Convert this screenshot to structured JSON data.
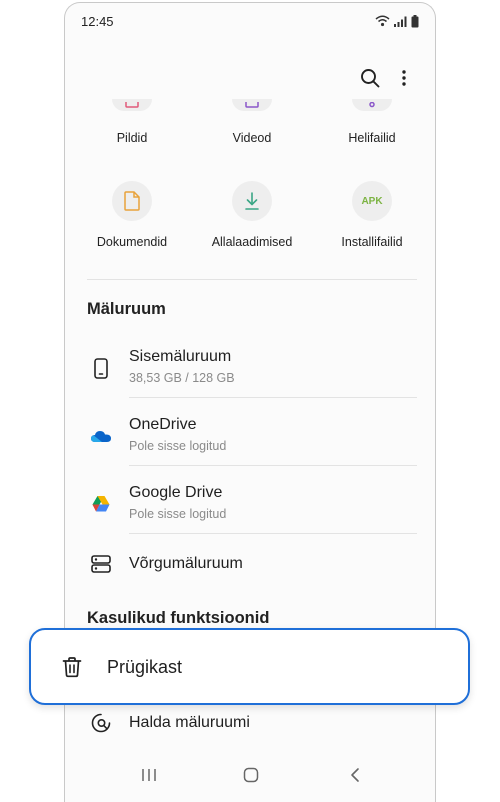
{
  "status_bar": {
    "time": "12:45"
  },
  "categories": [
    {
      "label": "Pildid",
      "icon": "image-icon"
    },
    {
      "label": "Videod",
      "icon": "video-icon"
    },
    {
      "label": "Helifailid",
      "icon": "audio-icon"
    },
    {
      "label": "Dokumendid",
      "icon": "document-icon"
    },
    {
      "label": "Allalaadimised",
      "icon": "download-icon"
    },
    {
      "label": "Installifailid",
      "icon": "apk-icon",
      "badge": "APK"
    }
  ],
  "storage": {
    "title": "Mäluruum",
    "items": [
      {
        "title": "Sisemäluruum",
        "subtitle": "38,53 GB / 128 GB",
        "icon": "phone-icon"
      },
      {
        "title": "OneDrive",
        "subtitle": "Pole sisse logitud",
        "icon": "onedrive-icon"
      },
      {
        "title": "Google Drive",
        "subtitle": "Pole sisse logitud",
        "icon": "google-drive-icon"
      },
      {
        "title": "Võrgumäluruum",
        "icon": "network-storage-icon"
      }
    ]
  },
  "useful": {
    "title": "Kasulikud funktsioonid",
    "trash_label": "Prügikast",
    "manage_label": "Halda mäluruumi"
  },
  "colors": {
    "highlight": "#1f6fd8",
    "apk": "#7cb342",
    "download": "#3aa685",
    "document": "#e8a23a"
  }
}
